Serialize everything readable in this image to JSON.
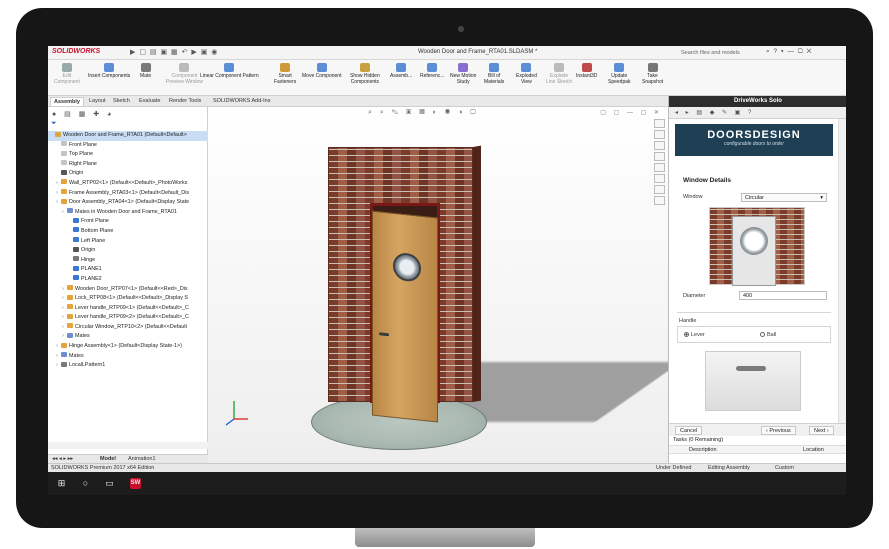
{
  "titlebar": {
    "app_name": "SOLIDWORKS",
    "document_title": "Wooden Door and Frame_RTA01.SLDASM *",
    "search_placeholder": "Search files and models"
  },
  "command_manager": [
    {
      "label": "Edit\nComponent",
      "dim": true
    },
    {
      "label": "Insert Components"
    },
    {
      "label": "Mate"
    },
    {
      "label": "Component\nPreview Window",
      "dim": true
    },
    {
      "label": "Linear Component Pattern"
    },
    {
      "label": "Smart\nFasteners"
    },
    {
      "label": "Move Component"
    },
    {
      "label": "Show Hidden\nComponents"
    },
    {
      "label": "Assemb..."
    },
    {
      "label": "Referenc..."
    },
    {
      "label": "New Motion\nStudy"
    },
    {
      "label": "Bill of\nMaterials"
    },
    {
      "label": "Exploded\nView"
    },
    {
      "label": "Explode\nLine Sketch",
      "dim": true
    },
    {
      "label": "Instant3D"
    },
    {
      "label": "Update\nSpeedpak"
    },
    {
      "label": "Take\nSnapshot"
    }
  ],
  "tabs": [
    "Assembly",
    "Layout",
    "Sketch",
    "Evaluate",
    "Render Tools",
    "SOLIDWORKS Add-Ins"
  ],
  "active_tab": "Assembly",
  "tree": {
    "rows": [
      {
        "text": "Wooden Door and Frame_RTA01  (Default<Default>",
        "indent": 0,
        "icon": "assembly",
        "selected": true
      },
      {
        "text": "Front Plane",
        "indent": 1,
        "icon": "plane"
      },
      {
        "text": "Top Plane",
        "indent": 1,
        "icon": "plane"
      },
      {
        "text": "Right Plane",
        "indent": 1,
        "icon": "plane"
      },
      {
        "text": "Origin",
        "indent": 1,
        "icon": "origin"
      },
      {
        "text": "Wall_RTP02<1> (Default<<Default>_PhotoWorks",
        "indent": 1,
        "icon": "part",
        "arrow": true
      },
      {
        "text": "Frame Assembly_RTA03<1> (Default<Default_Dis",
        "indent": 1,
        "icon": "assembly",
        "arrow": true
      },
      {
        "text": "Door Assembly_RTA04<1> (Default<Display State",
        "indent": 1,
        "icon": "assembly",
        "arrow": true
      },
      {
        "text": "Mates in Wooden Door and Frame_RTA01",
        "indent": 2,
        "icon": "mates",
        "arrow": true
      },
      {
        "text": "Front Plane",
        "indent": 3,
        "icon": "plane-blue"
      },
      {
        "text": "Bottom Plane",
        "indent": 3,
        "icon": "plane-blue"
      },
      {
        "text": "Left Plane",
        "indent": 3,
        "icon": "plane-blue"
      },
      {
        "text": "Origin",
        "indent": 3,
        "icon": "origin"
      },
      {
        "text": "Hinge",
        "indent": 3,
        "icon": "axis"
      },
      {
        "text": "PLANE1",
        "indent": 3,
        "icon": "plane-blue"
      },
      {
        "text": "PLANE2",
        "indent": 3,
        "icon": "plane-blue"
      },
      {
        "text": "Wooden Door_RTP07<1> (Default<<Red>_Dis",
        "indent": 2,
        "icon": "part",
        "arrow": true
      },
      {
        "text": "Lock_RTP08<1> (Default<<Default>_Display S",
        "indent": 2,
        "icon": "part",
        "arrow": true
      },
      {
        "text": "Lever handle_RTP09<1> (Default<<Default>_C",
        "indent": 2,
        "icon": "part",
        "arrow": true
      },
      {
        "text": "Lever handle_RTP09<2> (Default<<Default>_C",
        "indent": 2,
        "icon": "part",
        "arrow": true
      },
      {
        "text": "Circular Window_RTP10<2> (Default<<Default",
        "indent": 2,
        "icon": "part",
        "arrow": true
      },
      {
        "text": "Mates",
        "indent": 2,
        "icon": "mates",
        "arrow": true
      },
      {
        "text": "Hinge Assembly<1> (Default<Display State-1>)",
        "indent": 1,
        "icon": "assembly",
        "arrow": true
      },
      {
        "text": "Mates",
        "indent": 1,
        "icon": "mates",
        "arrow": true
      },
      {
        "text": "LocalLPattern1",
        "indent": 1,
        "icon": "pattern",
        "arrow": true
      }
    ]
  },
  "model_tabs": [
    "Model",
    "Animation1"
  ],
  "driveworks": {
    "title": "DriveWorks Solo",
    "brand": "DOORSDESIGN",
    "tagline": "configurable doors to order",
    "section_title": "Window Details",
    "window_label": "Window",
    "window_value": "Circular",
    "diameter_label": "Diameter",
    "diameter_value": "400",
    "handle_label": "Handle",
    "handle_options": [
      {
        "label": "Lever",
        "checked": true
      },
      {
        "label": "Ball",
        "checked": false
      }
    ],
    "cancel_label": "Cancel",
    "previous_label": "‹ Previous",
    "next_label": "Next ›",
    "tasks_title": "Tasks (0 Remaining)",
    "tasks_columns": [
      "Description",
      "Location"
    ]
  },
  "status": {
    "edition": "SOLIDWORKS Premium 2017 x64 Edition",
    "define_state": "Under Defined",
    "mode": "Editing Assembly",
    "units": "Custom"
  },
  "colors": {
    "brand_red": "#c8102e",
    "selection_blue": "#c9def5",
    "dw_banner": "#1f3f55"
  }
}
